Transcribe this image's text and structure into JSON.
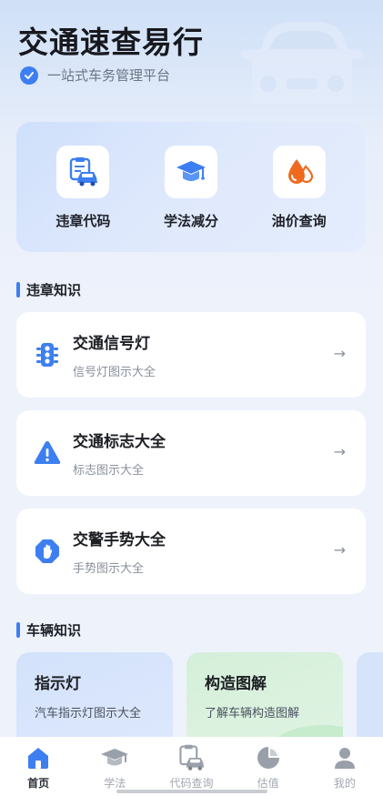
{
  "app": {
    "title": "交通速查易行",
    "subtitle": "一站式车务管理平台"
  },
  "colors": {
    "accent": "#3d7ff0",
    "quick_icon_blue": "#3d7ff0",
    "fuel_orange": "#f06a1e",
    "vehicle_card_1": "#d7e5fb",
    "vehicle_card_2": "#d8f0dc"
  },
  "quick_actions": [
    {
      "label": "违章代码",
      "icon": "car-document-icon"
    },
    {
      "label": "学法减分",
      "icon": "graduation-cap-icon"
    },
    {
      "label": "油价查询",
      "icon": "fuel-drop-icon"
    }
  ],
  "sections": {
    "violation_knowledge": "违章知识",
    "vehicle_knowledge": "车辆知识"
  },
  "knowledge_cards": [
    {
      "title": "交通信号灯",
      "subtitle": "信号灯图示大全",
      "icon": "traffic-light-icon",
      "arrow": "→"
    },
    {
      "title": "交通标志大全",
      "subtitle": "标志图示大全",
      "icon": "warning-sign-icon",
      "arrow": "→"
    },
    {
      "title": "交警手势大全",
      "subtitle": "手势图示大全",
      "icon": "hand-stop-icon",
      "arrow": "→"
    }
  ],
  "vehicle_cards": [
    {
      "title": "指示灯",
      "subtitle": "汽车指示灯图示大全"
    },
    {
      "title": "构造图解",
      "subtitle": "了解车辆构造图解"
    }
  ],
  "tabs": [
    {
      "label": "首页",
      "icon": "home-icon",
      "active": true
    },
    {
      "label": "学法",
      "icon": "graduation-cap-icon",
      "active": false
    },
    {
      "label": "代码查询",
      "icon": "car-document-icon",
      "active": false
    },
    {
      "label": "估值",
      "icon": "pie-chart-icon",
      "active": false
    },
    {
      "label": "我的",
      "icon": "user-icon",
      "active": false
    }
  ]
}
